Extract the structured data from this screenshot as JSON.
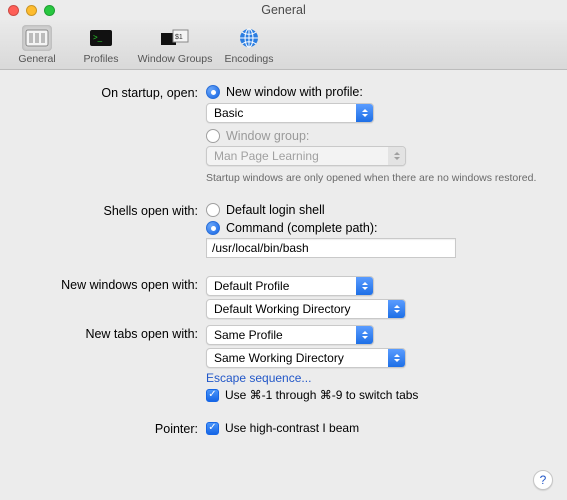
{
  "window": {
    "title": "General"
  },
  "toolbar": {
    "general": "General",
    "profiles": "Profiles",
    "window_groups": "Window Groups",
    "encodings": "Encodings"
  },
  "startup": {
    "label": "On startup, open:",
    "opt_new_window": "New window with profile:",
    "profile_selected": "Basic",
    "opt_window_group": "Window group:",
    "group_selected": "Man Page Learning",
    "note": "Startup windows are only opened when there are no windows restored."
  },
  "shells": {
    "label": "Shells open with:",
    "opt_default": "Default login shell",
    "opt_command": "Command (complete path):",
    "command_value": "/usr/local/bin/bash"
  },
  "newwin": {
    "label": "New windows open with:",
    "profile": "Default Profile",
    "dir": "Default Working Directory"
  },
  "newtab": {
    "label": "New tabs open with:",
    "profile": "Same Profile",
    "dir": "Same Working Directory",
    "escape_link": "Escape sequence...",
    "switch_tabs": "Use ⌘-1 through ⌘-9 to switch tabs"
  },
  "pointer": {
    "label": "Pointer:",
    "ibeam": "Use high-contrast I beam"
  },
  "help": "?"
}
